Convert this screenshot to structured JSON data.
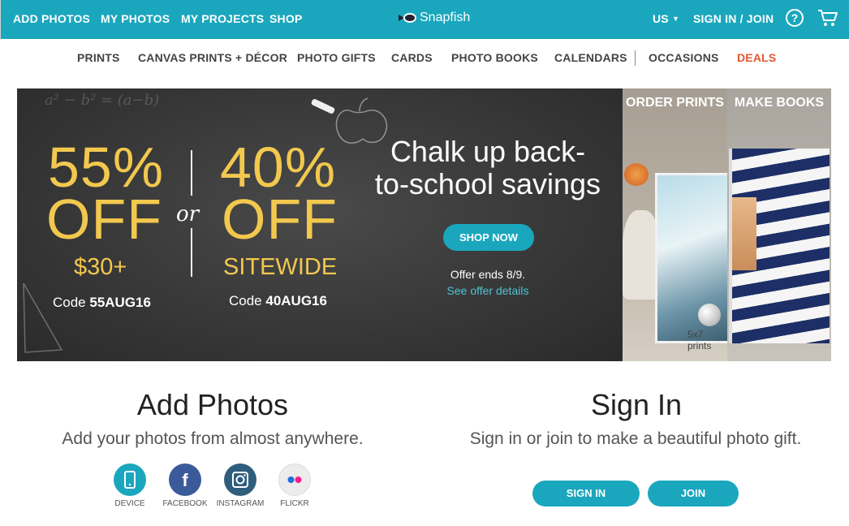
{
  "topbar": {
    "add_photos": "ADD PHOTOS",
    "my_photos": "MY PHOTOS",
    "my_projects": "MY PROJECTS",
    "shop": "SHOP",
    "brand": "Snapfish",
    "region": "US",
    "sign_in_join": "SIGN IN / JOIN",
    "help_icon": "?",
    "bg_color": "#1aa7bd"
  },
  "catnav": {
    "items": [
      "PRINTS",
      "CANVAS PRINTS + DÉCOR",
      "PHOTO GIFTS",
      "CARDS",
      "PHOTO BOOKS",
      "CALENDARS",
      "OCCASIONS",
      "DEALS"
    ],
    "deals_color": "#e4572e"
  },
  "hero": {
    "offer1_percent": "55%",
    "offer1_off": "OFF",
    "offer1_min": "$30+",
    "offer1_code_label": "Code",
    "offer1_code": "55AUG16",
    "or": "or",
    "offer2_percent": "40%",
    "offer2_off": "OFF",
    "offer2_scope": "SITEWIDE",
    "offer2_code_label": "Code",
    "offer2_code": "40AUG16",
    "headline": "Chalk up back-to-school savings",
    "cta": "SHOP NOW",
    "offer_ends": "Offer ends 8/9.",
    "offer_link": "See offer details",
    "accent_color": "#f2c84e"
  },
  "promos": {
    "order_prints": "ORDER PRINTS",
    "print_size": "5x7 prints",
    "make_books": "MAKE BOOKS"
  },
  "add_photos": {
    "title": "Add Photos",
    "subtitle": "Add your photos from almost anywhere.",
    "sources": [
      {
        "label": "DEVICE",
        "icon": "device-icon",
        "color": "#1aa7bd"
      },
      {
        "label": "FACEBOOK",
        "icon": "facebook-icon",
        "color": "#3b5a9a"
      },
      {
        "label": "INSTAGRAM",
        "icon": "instagram-icon",
        "color": "#2f5d7c"
      },
      {
        "label": "FLICKR",
        "icon": "flickr-icon",
        "color": "#ececec"
      }
    ]
  },
  "sign_in": {
    "title": "Sign In",
    "subtitle": "Sign in or join to make a beautiful photo gift.",
    "sign_in_button": "SIGN IN",
    "join_button": "JOIN"
  }
}
